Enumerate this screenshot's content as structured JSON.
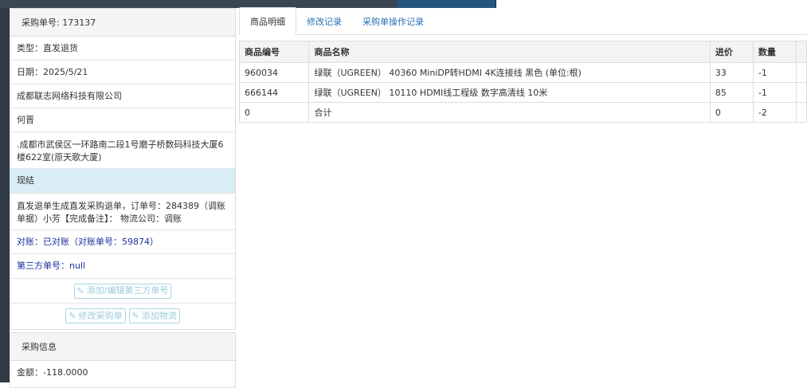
{
  "order_panel": {
    "title": "采购单号: 173137",
    "type": "类型：直发退货",
    "date": "日期：2025/5/21",
    "supplier": "成都联志网络科技有限公司",
    "contact": "何晋",
    "address": ".成都市武侯区一环路南二段1号磨子桥数码科技大厦6楼622室(原天歌大厦)",
    "payment": "现结",
    "remark": "直发退单生成直发采购退单，订单号：284389（调账单据）小芳【完成备注】：  物流公司：调账",
    "reconcile": "对账：已对账（对账单号：59874）",
    "third_party": "第三方单号：null",
    "buttons": {
      "add_third_party": "添加/编辑第三方单号",
      "edit_order": "修改采购单",
      "add_logistics": "添加物流"
    }
  },
  "purchase_info": {
    "title": "采购信息",
    "amount": "金额：-118.0000"
  },
  "tabs": [
    {
      "label": "商品明细",
      "active": true
    },
    {
      "label": "修改记录",
      "active": false
    },
    {
      "label": "采购单操作记录",
      "active": false
    }
  ],
  "table": {
    "headers": [
      "商品编号",
      "商品名称",
      "进价",
      "数量"
    ],
    "rows": [
      [
        "960034",
        "绿联（UGREEN） 40360 MiniDP转HDMI 4K连接线 黑色 (单位:根)",
        "33",
        "-1"
      ],
      [
        "666144",
        "绿联（UGREEN） 10110 HDMI线工程级 数字高清线 10米",
        "85",
        "-1"
      ],
      [
        "0",
        "合计",
        "0",
        "-2"
      ]
    ]
  },
  "colors": {
    "accent_link": "#2a6fb5",
    "highlight_row": "#d9edf7",
    "reconcile_text": "#1a2d9e",
    "disabled_button": "#9ccbdc"
  }
}
